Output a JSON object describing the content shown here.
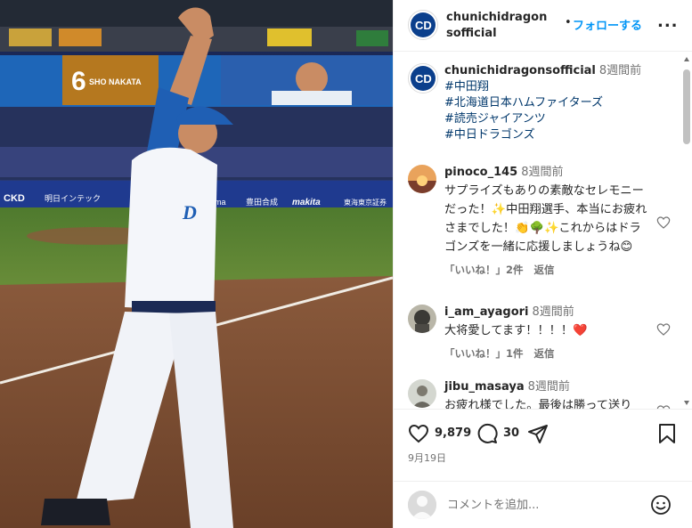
{
  "photo": {
    "scoreboard": {
      "number": "6",
      "name": "SHO NAKATA",
      "sponsors": [
        "CKD",
        "明日インテック",
        "Bloma",
        "豊田合成",
        "makita",
        "東海東京証券"
      ]
    }
  },
  "header": {
    "username": "chunichidragonsofficial",
    "dot": "•",
    "follow_label": "フォローする",
    "more_label": "..."
  },
  "caption": {
    "username": "chunichidragonsofficial",
    "time": "8週間前",
    "hashtags": [
      "#中田翔",
      "#北海道日本ハムファイターズ",
      "#読売ジャイアンツ",
      "#中日ドラゴンズ"
    ]
  },
  "comments": [
    {
      "username": "pinoco_145",
      "time": "8週間前",
      "text": "サプライズもありの素敵なセレモニーだった！✨中田翔選手、本当にお疲れさまでした！👏🌳✨これからはドラゴンズを一緒に応援しましょうね😊",
      "likes": "「いいね！」2件",
      "reply": "返信"
    },
    {
      "username": "i_am_ayagori",
      "time": "8週間前",
      "text": "大将愛してます！！！！❤️",
      "likes": "「いいね！」1件",
      "reply": "返信"
    },
    {
      "username": "jibu_masaya",
      "time": "8週間前",
      "text": "お疲れ様でした。最後は勝って送り",
      "likes": "",
      "reply": ""
    }
  ],
  "actions": {
    "like_count": "9,879",
    "comment_count": "30",
    "date": "9月19日"
  },
  "comment_input": {
    "placeholder": "コメントを追加..."
  },
  "colors": {
    "link": "#0095f6",
    "hashtag": "#00376b",
    "secondary": "#737373",
    "heart_red": "#ed4956"
  }
}
